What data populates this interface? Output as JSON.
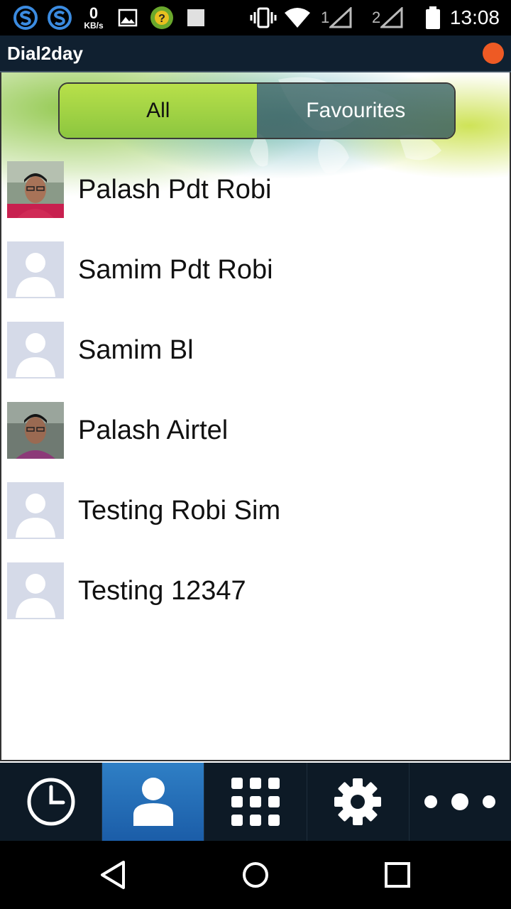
{
  "status_bar": {
    "speed_value": "0",
    "speed_unit": "KB/s",
    "sim1": "1",
    "sim2": "2",
    "time": "13:08",
    "icons": [
      "s-app-icon",
      "s-app-icon",
      "image-icon",
      "app-notification-icon",
      "square-icon",
      "vibrate-icon",
      "wifi-icon",
      "signal-icon",
      "signal-icon",
      "battery-icon"
    ]
  },
  "app_bar": {
    "title": "Dial2day",
    "status_dot_color": "#ee5a24"
  },
  "tabs": {
    "all": "All",
    "favourites": "Favourites",
    "active": "All"
  },
  "contacts": [
    {
      "name": "Palash Pdt Robi",
      "avatar": "photo"
    },
    {
      "name": "Samim Pdt Robi",
      "avatar": "placeholder"
    },
    {
      "name": "Samim Bl",
      "avatar": "placeholder"
    },
    {
      "name": "Palash Airtel",
      "avatar": "photo"
    },
    {
      "name": "Testing Robi Sim",
      "avatar": "placeholder"
    },
    {
      "name": "Testing 12347",
      "avatar": "placeholder"
    }
  ],
  "bottom_nav": [
    {
      "icon": "clock-icon",
      "active": false
    },
    {
      "icon": "contacts-icon",
      "active": true
    },
    {
      "icon": "dialpad-icon",
      "active": false
    },
    {
      "icon": "gear-icon",
      "active": false
    },
    {
      "icon": "more-icon",
      "active": false
    }
  ],
  "colors": {
    "accent_green": "#8cc63f",
    "active_blue": "#1b5da8",
    "appbar": "#102030"
  }
}
